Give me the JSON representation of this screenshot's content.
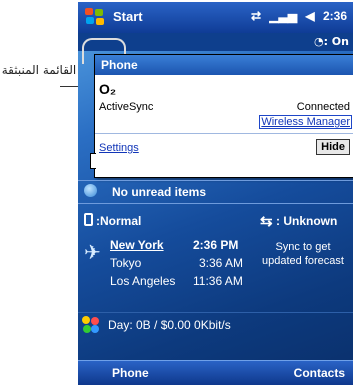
{
  "callout": {
    "text": "القائمة المنبثقة"
  },
  "status_bar": {
    "start_label": "Start",
    "sync_icon": "sync-arrows-icon",
    "signal_icon": "signal-bars-icon",
    "volume_icon": "speaker-icon",
    "time": "2:36"
  },
  "background_strip": {
    "right_text": "◔: On"
  },
  "popup": {
    "title": "Phone",
    "operator": "O₂",
    "activesync_label": "ActiveSync",
    "status": "Connected",
    "wireless_manager_link": "Wireless Manager",
    "settings_link": "Settings",
    "hide_button": "Hide"
  },
  "today": {
    "unread": "No unread items",
    "profile": ":Normal",
    "network": ": Unknown",
    "weather": {
      "cities": [
        {
          "name": "New York",
          "time": "2:36 PM"
        },
        {
          "name": "Tokyo",
          "time": "3:36 AM"
        },
        {
          "name": "Los Angeles",
          "time": "11:36 AM"
        }
      ],
      "sync_text": "Sync to get updated forecast"
    },
    "usage": "Day: 0B / $0.00  0Kbit/s"
  },
  "softkeys": {
    "left": "Phone",
    "right": "Contacts"
  }
}
